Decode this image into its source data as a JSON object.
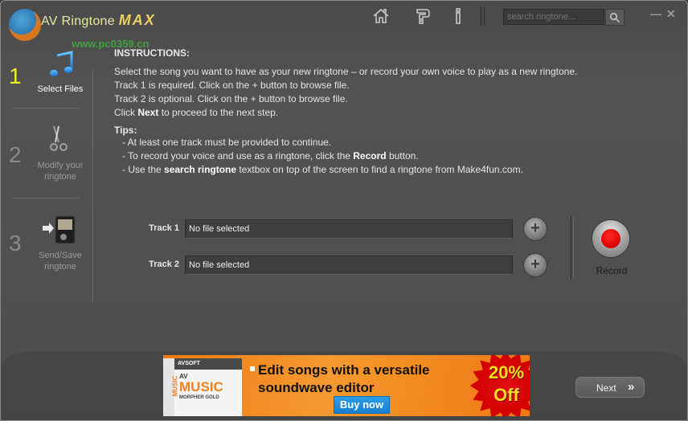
{
  "app": {
    "title_prefix": "AV Ringtone ",
    "title_suffix": "MAX",
    "watermark": "www.pc0359.cn"
  },
  "toolbar": {
    "icons": [
      "home-icon",
      "help-icon",
      "info-icon"
    ],
    "search_placeholder": "search ringtone...",
    "minimize_glyph": "—",
    "close_glyph": "✕"
  },
  "sidebar": {
    "steps": [
      {
        "number": "1",
        "label": "Select Files",
        "icon": "music-note-icon",
        "active": true
      },
      {
        "number": "2",
        "label": "Modify your ringtone",
        "icon": "scissors-icon",
        "active": false
      },
      {
        "number": "3",
        "label": "Send/Save ringtone",
        "icon": "phone-transfer-icon",
        "active": false
      }
    ]
  },
  "instructions": {
    "heading": "INSTRUCTIONS:",
    "line1": "Select the song you want to have as your new ringtone – or record your own voice to play as a new ringtone.",
    "line2": "Track 1 is required. Click on the + button to browse file.",
    "line3": "Track 2 is optional. Click on the + button to browse file.",
    "line4_pre": "Click ",
    "line4_bold": "Next",
    "line4_post": " to proceed to the next step."
  },
  "tips": {
    "heading": "Tips:",
    "tip1": "- At least one track must be provided to continue.",
    "tip2_pre": "- To record your voice and use as a ringtone, click the ",
    "tip2_bold": "Record",
    "tip2_post": " button.",
    "tip3_pre": "- Use the ",
    "tip3_bold": "search ringtone",
    "tip3_post": " textbox on top of the screen to find a ringtone from Make4fun.com."
  },
  "tracks": [
    {
      "label": "Track 1",
      "value": "No file selected"
    },
    {
      "label": "Track 2",
      "value": "No file selected"
    }
  ],
  "record": {
    "label": "Record"
  },
  "ad": {
    "box_brand": "AVSOFT",
    "box_av": "AV",
    "box_music": "MUSIC",
    "box_morpher": "MORPHER GOLD",
    "box_side": "MUSIC",
    "headline_line1": "Edit songs with a versatile",
    "headline_line2": "soundwave editor",
    "buy_label": "Buy now",
    "discount_line1": "20%",
    "discount_line2": "Off"
  },
  "footer": {
    "next_label": "Next",
    "next_glyph": "»"
  },
  "colors": {
    "active_step": "#f2ef2a",
    "record_red": "#dd0000",
    "ad_orange": "#f59a30",
    "buy_blue": "#1a7fd0"
  }
}
